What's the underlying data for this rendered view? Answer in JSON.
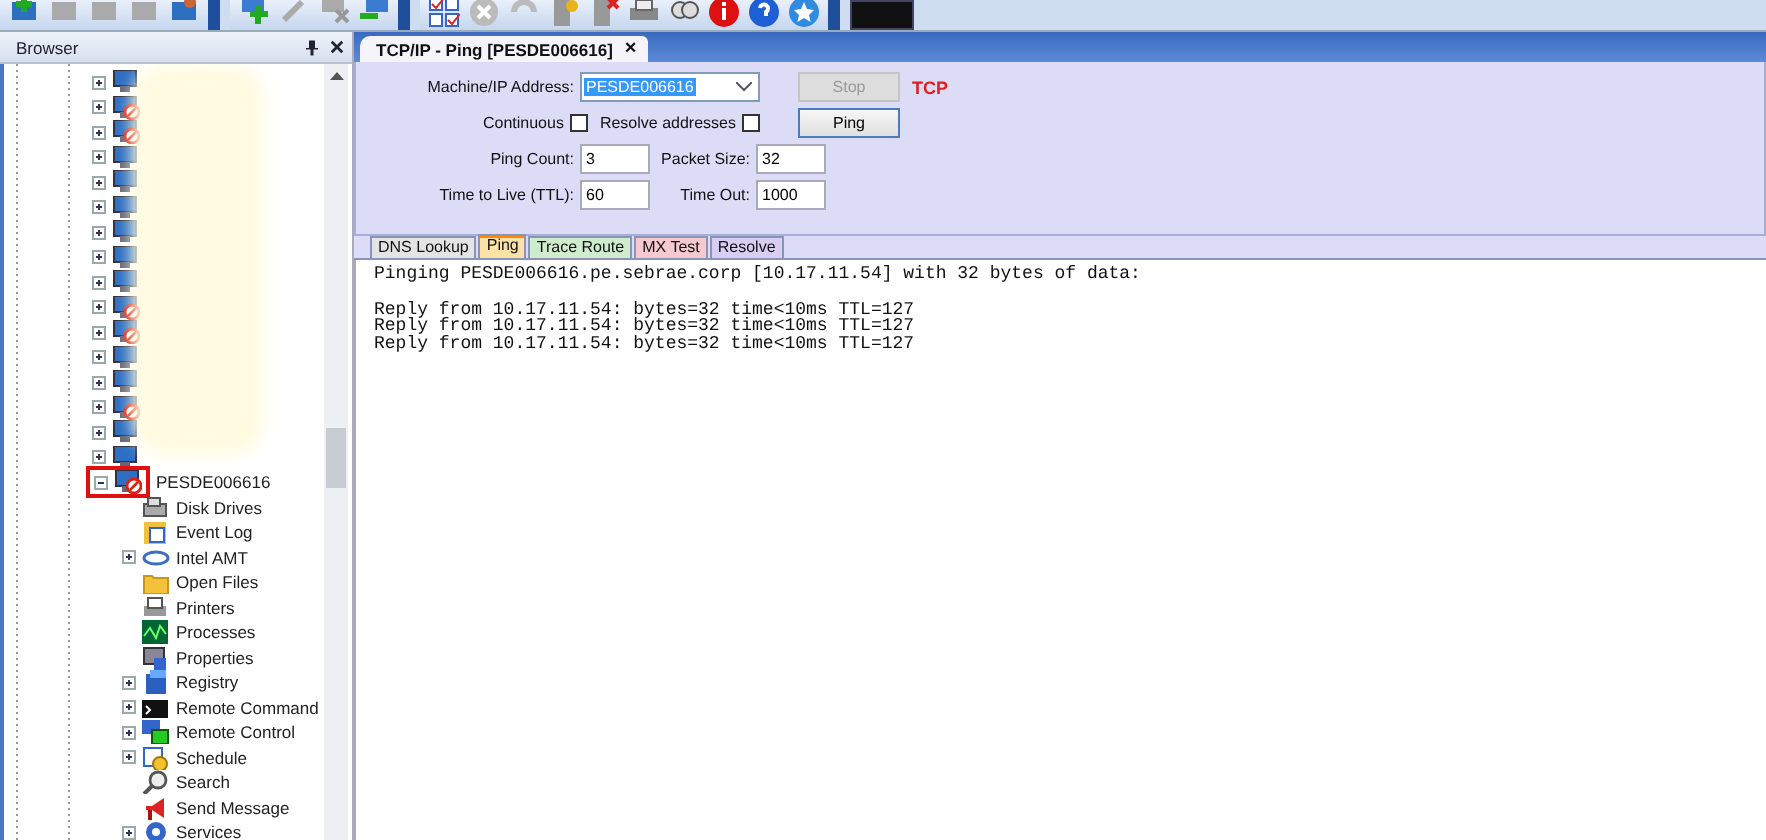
{
  "browser": {
    "title": "Browser",
    "computers": [
      {
        "offline": false
      },
      {
        "offline": true
      },
      {
        "offline": true
      },
      {
        "offline": false
      },
      {
        "offline": false
      },
      {
        "offline": false
      },
      {
        "offline": false
      },
      {
        "offline": false
      },
      {
        "offline": false
      },
      {
        "offline": true
      },
      {
        "offline": true
      },
      {
        "offline": false
      },
      {
        "offline": false
      },
      {
        "offline": true
      },
      {
        "offline": false
      },
      {
        "offline": false
      }
    ],
    "node": {
      "label": "PESDE006616",
      "offline": true,
      "expanded": true,
      "highlighted": true,
      "children": [
        {
          "label": "Disk Drives",
          "expandable": false
        },
        {
          "label": "Event Log",
          "expandable": false
        },
        {
          "label": "Intel AMT",
          "expandable": true
        },
        {
          "label": "Open Files",
          "expandable": false
        },
        {
          "label": "Printers",
          "expandable": false
        },
        {
          "label": "Processes",
          "expandable": false
        },
        {
          "label": "Properties",
          "expandable": false
        },
        {
          "label": "Registry",
          "expandable": true
        },
        {
          "label": "Remote Command",
          "expandable": true
        },
        {
          "label": "Remote Control",
          "expandable": true
        },
        {
          "label": "Schedule",
          "expandable": true
        },
        {
          "label": "Search",
          "expandable": false
        },
        {
          "label": "Send Message",
          "expandable": false
        },
        {
          "label": "Services",
          "expandable": true
        }
      ]
    }
  },
  "document_tab": {
    "title": "TCP/IP - Ping [PESDE006616]",
    "close": "×"
  },
  "form": {
    "address_label": "Machine/IP Address:",
    "address": "PESDE006616",
    "stop": {
      "label": "Stop",
      "disabled": true
    },
    "protocol": "TCP",
    "continuous": {
      "label": "Continuous",
      "checked": false
    },
    "resolve": {
      "label": "Resolve addresses",
      "checked": false
    },
    "ping": {
      "label": "Ping",
      "disabled": false
    },
    "ping_count": {
      "label": "Ping Count:",
      "value": "3"
    },
    "packet_size": {
      "label": "Packet Size:",
      "value": "32"
    },
    "ttl": {
      "label": "Time to Live (TTL):",
      "value": "60"
    },
    "timeout": {
      "label": "Time Out:",
      "value": "1000"
    }
  },
  "tabs": [
    {
      "label": "DNS Lookup",
      "selected": false,
      "color": "#e4e4e4"
    },
    {
      "label": "Ping",
      "selected": true,
      "color": "#fbe3a8"
    },
    {
      "label": "Trace Route",
      "selected": false,
      "color": "#cfeccf"
    },
    {
      "label": "MX Test",
      "selected": false,
      "color": "#f6c8d0"
    },
    {
      "label": "Resolve",
      "selected": false,
      "color": "#d8cdf2"
    }
  ],
  "output": {
    "header": "Pinging PESDE006616.pe.sebrae.corp [10.17.11.54] with 32 bytes of data:",
    "replies": [
      "Reply from 10.17.11.54: bytes=32 time<10ms TTL=127",
      "Reply from 10.17.11.54: bytes=32 time<10ms TTL=127",
      "Reply from 10.17.11.54: bytes=32 time<10ms TTL=127"
    ]
  }
}
